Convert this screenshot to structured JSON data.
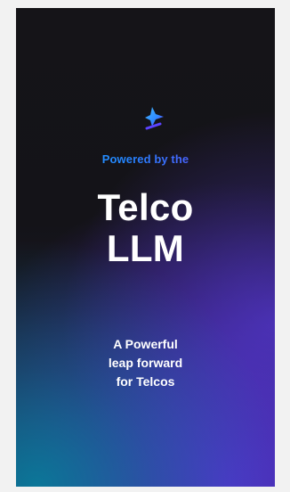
{
  "content": {
    "tagline": "Powered by the",
    "title_lines": [
      "Telco",
      "LLM"
    ],
    "subtitle_lines": [
      "A Powerful",
      "leap forward",
      "for Telcos"
    ]
  },
  "icons": {
    "top_mark": "sparkle-icon"
  },
  "colors": {
    "page_background": "#f2f2f2",
    "card_dark": "#141318",
    "teal_glow": "#008aa0",
    "purple_glow": "#542dcd",
    "text": "#ffffff",
    "gradient_start": "#2da7ff",
    "gradient_end": "#7a35ff"
  }
}
